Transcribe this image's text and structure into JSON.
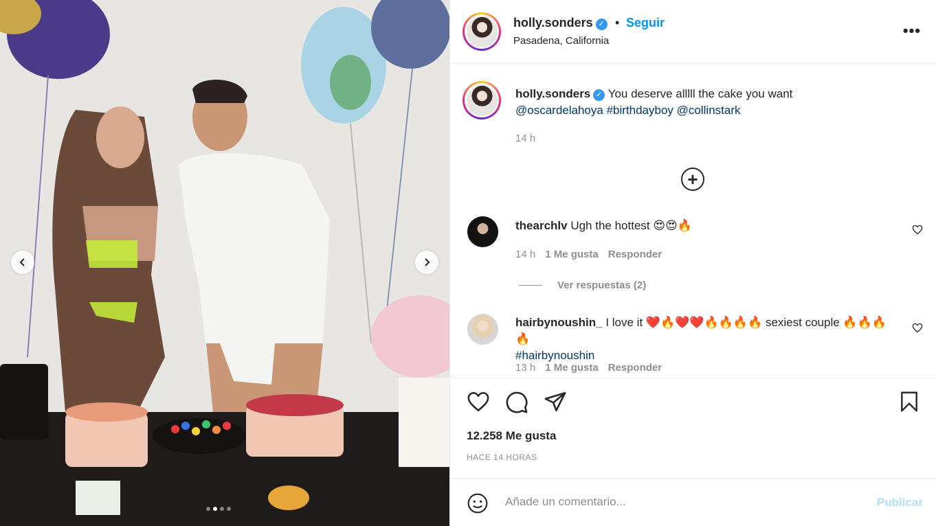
{
  "post": {
    "carousel_prev_icon": "chevron-left-icon",
    "carousel_next_icon": "chevron-right-icon",
    "slide_count": 4,
    "active_slide": 2
  },
  "header": {
    "username": "holly.sonders",
    "verified_icon": "verified-badge-icon",
    "bullet": "•",
    "follow_label": "Seguir",
    "location": "Pasadena, California",
    "more_label": "•••"
  },
  "caption": {
    "username": "holly.sonders",
    "text": "You deserve alllll the cake you want",
    "mention_1": "@oscardelahoya",
    "hashtag": "#birthdayboy",
    "mention_2": "@collinstark",
    "time": "14 h"
  },
  "load_more": {
    "label": "+"
  },
  "comments": [
    {
      "username": "thearchlv",
      "text": "Ugh the hottest 😍😍🔥",
      "time": "14 h",
      "likes": "1 Me gusta",
      "reply_label": "Responder",
      "view_replies": "Ver respuestas (2)"
    },
    {
      "username": "hairbynoushin_",
      "text": "I love it ❤️🔥❤️❤️🔥🔥🔥🔥 sexiest couple 🔥🔥🔥🔥",
      "hashtag": "#hairbynoushin",
      "time": "13 h",
      "likes": "1 Me gusta",
      "reply_label": "Responder"
    }
  ],
  "actions": {
    "like_icon": "heart-icon",
    "comment_icon": "comment-icon",
    "share_icon": "send-icon",
    "save_icon": "bookmark-icon",
    "likes_count": "12.258 Me gusta",
    "posted": "HACE 14 HORAS"
  },
  "composer": {
    "emoji_icon": "smiley-icon",
    "placeholder": "Añade un comentario...",
    "publish_label": "Publicar"
  },
  "colors": {
    "accent": "#0095f6",
    "link": "#00376b",
    "muted": "#8e8e8e",
    "publish_disabled": "#b2dffc"
  }
}
